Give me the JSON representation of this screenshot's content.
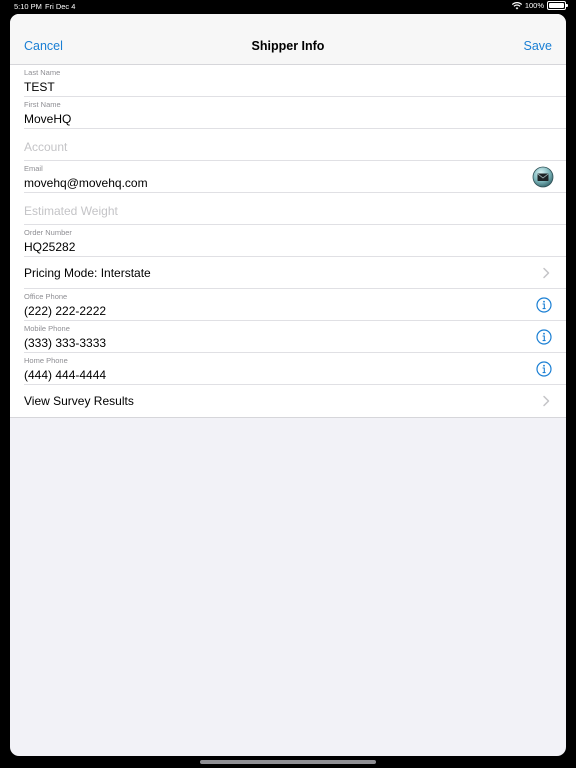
{
  "status": {
    "time": "5:10 PM",
    "date": "Fri Dec 4",
    "battery": "100%"
  },
  "nav": {
    "cancel": "Cancel",
    "title": "Shipper Info",
    "save": "Save"
  },
  "fields": {
    "last_name": {
      "label": "Last Name",
      "value": "TEST"
    },
    "first_name": {
      "label": "First Name",
      "value": "MoveHQ"
    },
    "account": {
      "placeholder": "Account"
    },
    "email": {
      "label": "Email",
      "value": "movehq@movehq.com"
    },
    "estimated_weight": {
      "placeholder": "Estimated Weight"
    },
    "order_number": {
      "label": "Order Number",
      "value": "HQ25282"
    },
    "pricing_mode": {
      "text": "Pricing Mode: Interstate"
    },
    "office_phone": {
      "label": "Office Phone",
      "value": "(222) 222-2222"
    },
    "mobile_phone": {
      "label": "Mobile Phone",
      "value": "(333) 333-3333"
    },
    "home_phone": {
      "label": "Home Phone",
      "value": "(444) 444-4444"
    },
    "survey_results": {
      "text": "View Survey Results"
    }
  },
  "colors": {
    "accent": "#1a7fd4",
    "background": "#f2f2f7"
  },
  "icons": [
    "wifi-icon",
    "battery-icon",
    "mail-icon",
    "info-icon",
    "chevron-right-icon"
  ]
}
